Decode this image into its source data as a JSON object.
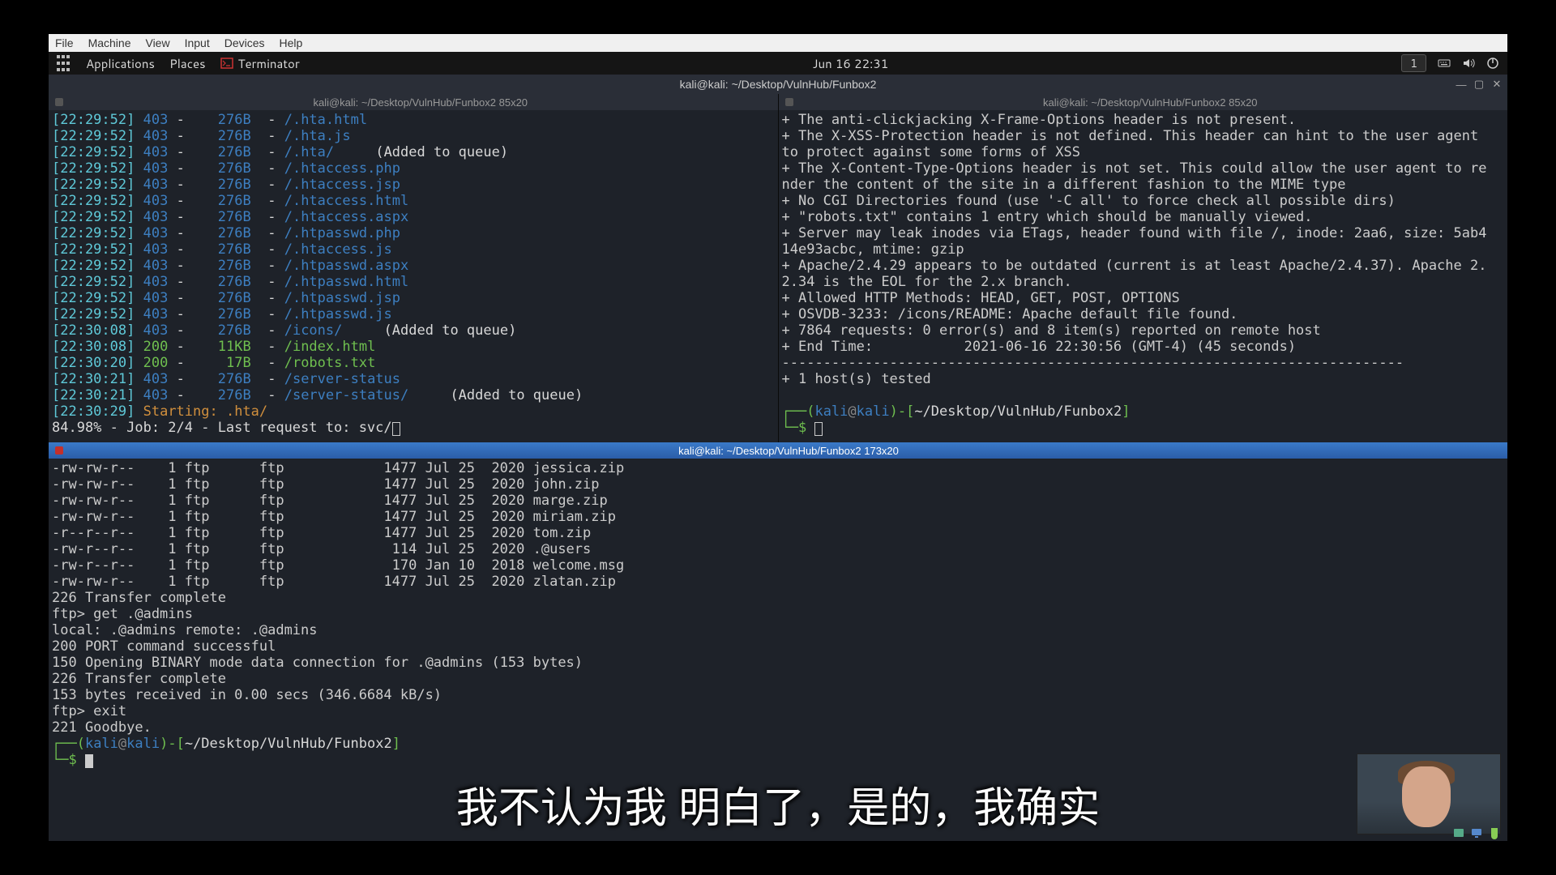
{
  "vbox_menu": {
    "file": "File",
    "machine": "Machine",
    "view": "View",
    "input": "Input",
    "devices": "Devices",
    "help": "Help"
  },
  "gnome": {
    "applications": "Applications",
    "places": "Places",
    "app_name": "Terminator",
    "clock": "Jun 16  22:31",
    "workspace": "1"
  },
  "titlebar": "kali@kali: ~/Desktop/VulnHub/Funbox2",
  "pane_left_title": "kali@kali: ~/Desktop/VulnHub/Funbox2 85x20",
  "pane_right_title": "kali@kali: ~/Desktop/VulnHub/Funbox2 85x20",
  "pane_bottom_title": "kali@kali: ~/Desktop/VulnHub/Funbox2 173x20",
  "dirb": {
    "rows": [
      {
        "t": "[22:29:52]",
        "code": "403",
        "size": "276B",
        "path": "/.hta.html",
        "extra": ""
      },
      {
        "t": "[22:29:52]",
        "code": "403",
        "size": "276B",
        "path": "/.hta.js",
        "extra": ""
      },
      {
        "t": "[22:29:52]",
        "code": "403",
        "size": "276B",
        "path": "/.hta/",
        "extra": "(Added to queue)"
      },
      {
        "t": "[22:29:52]",
        "code": "403",
        "size": "276B",
        "path": "/.htaccess.php",
        "extra": ""
      },
      {
        "t": "[22:29:52]",
        "code": "403",
        "size": "276B",
        "path": "/.htaccess.jsp",
        "extra": ""
      },
      {
        "t": "[22:29:52]",
        "code": "403",
        "size": "276B",
        "path": "/.htaccess.html",
        "extra": ""
      },
      {
        "t": "[22:29:52]",
        "code": "403",
        "size": "276B",
        "path": "/.htaccess.aspx",
        "extra": ""
      },
      {
        "t": "[22:29:52]",
        "code": "403",
        "size": "276B",
        "path": "/.htpasswd.php",
        "extra": ""
      },
      {
        "t": "[22:29:52]",
        "code": "403",
        "size": "276B",
        "path": "/.htaccess.js",
        "extra": ""
      },
      {
        "t": "[22:29:52]",
        "code": "403",
        "size": "276B",
        "path": "/.htpasswd.aspx",
        "extra": ""
      },
      {
        "t": "[22:29:52]",
        "code": "403",
        "size": "276B",
        "path": "/.htpasswd.html",
        "extra": ""
      },
      {
        "t": "[22:29:52]",
        "code": "403",
        "size": "276B",
        "path": "/.htpasswd.jsp",
        "extra": ""
      },
      {
        "t": "[22:29:52]",
        "code": "403",
        "size": "276B",
        "path": "/.htpasswd.js",
        "extra": ""
      },
      {
        "t": "[22:30:08]",
        "code": "403",
        "size": "276B",
        "path": "/icons/",
        "extra": "(Added to queue)"
      },
      {
        "t": "[22:30:08]",
        "code": "200",
        "size": "11KB",
        "path": "/index.html",
        "extra": ""
      },
      {
        "t": "[22:30:20]",
        "code": "200",
        "size": "17B",
        "path": "/robots.txt",
        "extra": ""
      },
      {
        "t": "[22:30:21]",
        "code": "403",
        "size": "276B",
        "path": "/server-status",
        "extra": ""
      },
      {
        "t": "[22:30:21]",
        "code": "403",
        "size": "276B",
        "path": "/server-status/",
        "extra": "(Added to queue)"
      }
    ],
    "starting_ts": "[22:30:29]",
    "starting": "Starting: .hta/",
    "progress": "84.98% - Job: 2/4 - Last request to: svc/"
  },
  "nikto": {
    "lines": [
      "+ The anti-clickjacking X-Frame-Options header is not present.",
      "+ The X-XSS-Protection header is not defined. This header can hint to the user agent to protect against some forms of XSS",
      "+ The X-Content-Type-Options header is not set. This could allow the user agent to render the content of the site in a different fashion to the MIME type",
      "+ No CGI Directories found (use '-C all' to force check all possible dirs)",
      "+ \"robots.txt\" contains 1 entry which should be manually viewed.",
      "+ Server may leak inodes via ETags, header found with file /, inode: 2aa6, size: 5ab414e93acbc, mtime: gzip",
      "+ Apache/2.4.29 appears to be outdated (current is at least Apache/2.4.37). Apache 2.2.34 is the EOL for the 2.x branch.",
      "+ Allowed HTTP Methods: HEAD, GET, POST, OPTIONS",
      "+ OSVDB-3233: /icons/README: Apache default file found.",
      "+ 7864 requests: 0 error(s) and 8 item(s) reported on remote host",
      "+ End Time:           2021-06-16 22:30:56 (GMT-4) (45 seconds)",
      "---------------------------------------------------------------------------",
      "+ 1 host(s) tested"
    ]
  },
  "prompt": {
    "user": "kali",
    "host": "kali",
    "at": "@",
    "path": "~/Desktop/VulnHub/Funbox2",
    "open": "┌──(",
    "close": ")-[",
    "end": "]",
    "line2": "└─$ "
  },
  "ftp": {
    "listing": [
      {
        "perm": "-rw-rw-r--",
        "n": "1",
        "own": "ftp",
        "grp": "ftp",
        "size": "1477",
        "date": "Jul 25  2020",
        "name": "jessica.zip"
      },
      {
        "perm": "-rw-rw-r--",
        "n": "1",
        "own": "ftp",
        "grp": "ftp",
        "size": "1477",
        "date": "Jul 25  2020",
        "name": "john.zip"
      },
      {
        "perm": "-rw-rw-r--",
        "n": "1",
        "own": "ftp",
        "grp": "ftp",
        "size": "1477",
        "date": "Jul 25  2020",
        "name": "marge.zip"
      },
      {
        "perm": "-rw-rw-r--",
        "n": "1",
        "own": "ftp",
        "grp": "ftp",
        "size": "1477",
        "date": "Jul 25  2020",
        "name": "miriam.zip"
      },
      {
        "perm": "-r--r--r--",
        "n": "1",
        "own": "ftp",
        "grp": "ftp",
        "size": "1477",
        "date": "Jul 25  2020",
        "name": "tom.zip"
      },
      {
        "perm": "-rw-r--r--",
        "n": "1",
        "own": "ftp",
        "grp": "ftp",
        "size": "114",
        "date": "Jul 25  2020",
        "name": ".@users"
      },
      {
        "perm": "-rw-r--r--",
        "n": "1",
        "own": "ftp",
        "grp": "ftp",
        "size": "170",
        "date": "Jan 10  2018",
        "name": "welcome.msg"
      },
      {
        "perm": "-rw-rw-r--",
        "n": "1",
        "own": "ftp",
        "grp": "ftp",
        "size": "1477",
        "date": "Jul 25  2020",
        "name": "zlatan.zip"
      }
    ],
    "after": [
      "226 Transfer complete",
      "ftp> get .@admins",
      "local: .@admins remote: .@admins",
      "200 PORT command successful",
      "150 Opening BINARY mode data connection for .@admins (153 bytes)",
      "226 Transfer complete",
      "153 bytes received in 0.00 secs (346.6684 kB/s)",
      "ftp> exit",
      "221 Goodbye."
    ]
  },
  "subtitle": "我不认为我 明白了，是的，我确实"
}
